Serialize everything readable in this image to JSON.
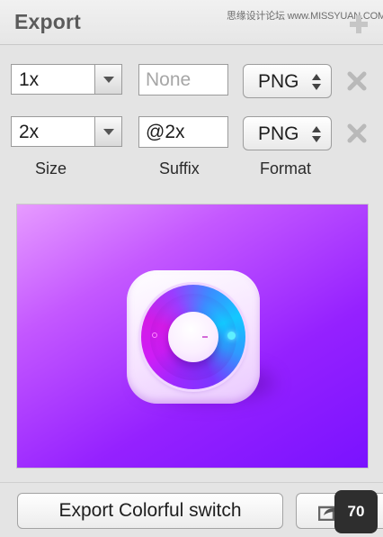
{
  "header": {
    "title": "Export",
    "watermark": "思缘设计论坛 www.MISSYUAN.COM",
    "add_icon": "plus-icon"
  },
  "export_rows": [
    {
      "scale": "1x",
      "suffix": "",
      "suffix_placeholder": "None",
      "format": "PNG",
      "remove_icon": "close-x-icon"
    },
    {
      "scale": "2x",
      "suffix": "@2x",
      "suffix_placeholder": "None",
      "format": "PNG",
      "remove_icon": "close-x-icon"
    }
  ],
  "column_labels": {
    "size": "Size",
    "suffix": "Suffix",
    "format": "Format"
  },
  "preview": {
    "icon": "colorful-switch-dial-icon",
    "background_from": "#e79bff",
    "background_to": "#7a12ff"
  },
  "footer": {
    "export_button_label": "Export Colorful switch",
    "share_icon": "share-arrow-icon",
    "badge_count": "70"
  }
}
